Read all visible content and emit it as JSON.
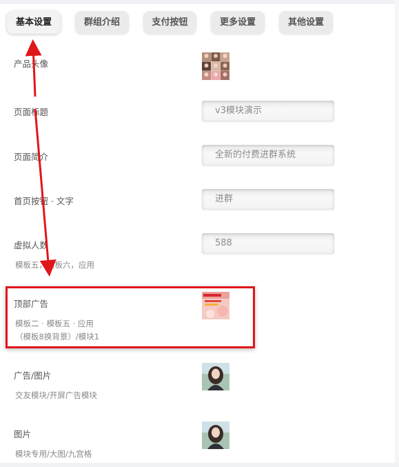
{
  "tabs": [
    {
      "label": "基本设置",
      "active": true
    },
    {
      "label": "群组介绍",
      "active": false
    },
    {
      "label": "支付按钮",
      "active": false
    },
    {
      "label": "更多设置",
      "active": false
    },
    {
      "label": "其他设置",
      "active": false
    }
  ],
  "fields": {
    "product_image": {
      "label": "产品头像"
    },
    "page_title": {
      "label": "页面标题",
      "value": "v3模块演示"
    },
    "page_intro": {
      "label": "页面简介",
      "value": "全新的付费进群系统"
    },
    "home_button": {
      "label": "首页按钮 · 文字",
      "value": "进群"
    },
    "virtual_count": {
      "label": "虚拟人数",
      "value": "588",
      "hint": "模板五，模板六，应用"
    },
    "top_ad": {
      "label": "顶部广告",
      "hint1": "模板二 · 模板五 · 应用",
      "hint2": "（模板8换背景）/模块1"
    },
    "ad_image": {
      "label": "广告/图片",
      "hint": "交友模块/开屏广告模块"
    },
    "image": {
      "label": "图片",
      "hint": "模块专用/大图/九宫格"
    }
  },
  "colors": {
    "annotation_red": "#e0161a"
  }
}
